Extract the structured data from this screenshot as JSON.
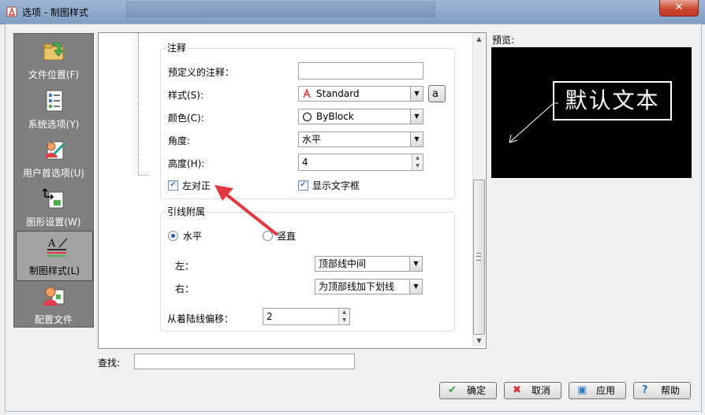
{
  "window": {
    "title": "选项 - 制图样式",
    "close_glyph": "✕"
  },
  "nav": {
    "items": [
      {
        "label": "文件位置(F)",
        "icon": "folder-icon"
      },
      {
        "label": "系统选项(Y)",
        "icon": "checklist-icon"
      },
      {
        "label": "用户首选项(U)",
        "icon": "user-prefs-icon"
      },
      {
        "label": "图形设置(W)",
        "icon": "graphics-icon"
      },
      {
        "label": "制图样式(L)",
        "icon": "drafting-style-icon",
        "selected": true
      },
      {
        "label": "配置文件",
        "icon": "profile-icon"
      }
    ]
  },
  "annotation": {
    "group_title": "注释",
    "predefined_label": "预定义的注释：",
    "predefined_value": "",
    "style_label": "样式(S):",
    "style_value": "Standard",
    "style_icon": "a",
    "color_label": "颜色(C):",
    "color_value": "ByBlock",
    "angle_label": "角度:",
    "angle_value": "水平",
    "height_label": "高度(H):",
    "height_value": "4",
    "left_align_label": "左对正",
    "left_align_checked": true,
    "show_textbox_label": "显示文字框",
    "show_textbox_checked": true
  },
  "leader": {
    "group_title": "引线附属",
    "horizontal_label": "水平",
    "vertical_label": "竖直",
    "selected": "horizontal",
    "left_label": "左：",
    "left_value": "顶部线中间",
    "right_label": "右：",
    "right_value": "为顶部线加下划线",
    "offset_label": "从着陆线偏移：",
    "offset_value": "2"
  },
  "preview": {
    "label": "预览:",
    "text": "默认文本"
  },
  "search": {
    "label": "查找:",
    "value": ""
  },
  "buttons": {
    "ok": "确定",
    "cancel": "取消",
    "apply": "应用",
    "help": "帮助"
  },
  "colors": {
    "accent_arrow": "#e0383e",
    "nav_bg": "#7f7f7f",
    "preview_bg": "#000000"
  }
}
